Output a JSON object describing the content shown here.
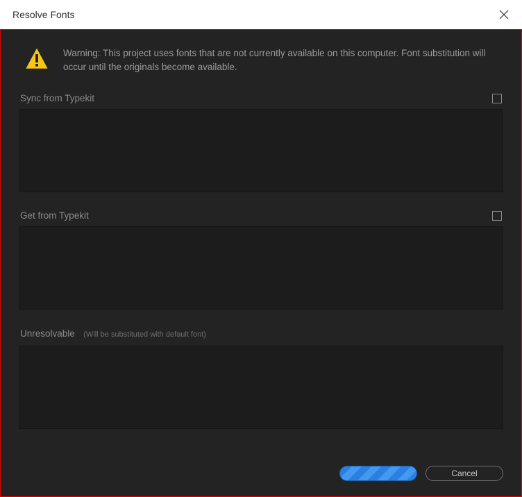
{
  "titlebar": {
    "title": "Resolve Fonts"
  },
  "warning": {
    "text": "Warning: This project uses fonts that are not currently available on this computer. Font substitution will occur until the originals become available."
  },
  "sections": {
    "sync": {
      "label": "Sync from Typekit"
    },
    "get": {
      "label": "Get from Typekit"
    },
    "unresolvable": {
      "label": "Unresolvable",
      "sublabel": "(Will be substituted with default font)"
    }
  },
  "buttons": {
    "ok": "",
    "cancel": "Cancel"
  }
}
